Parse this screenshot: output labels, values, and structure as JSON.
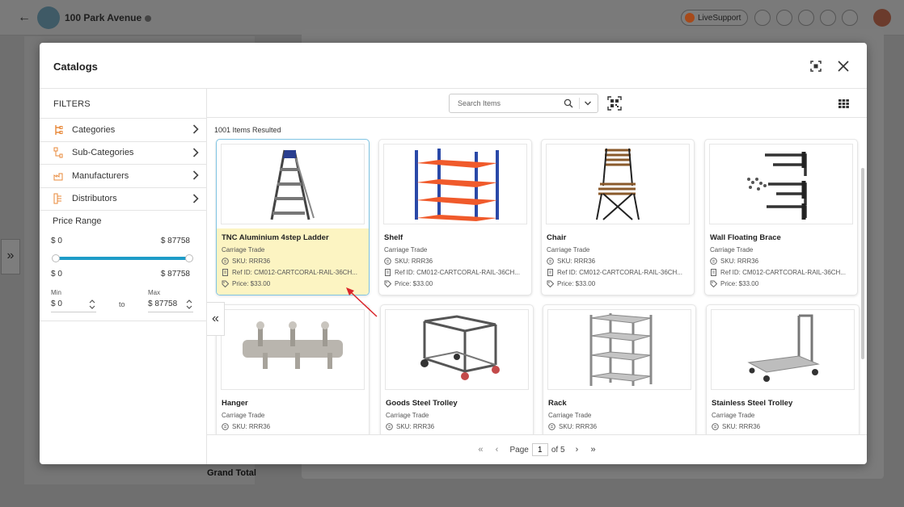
{
  "background": {
    "address": "100 Park Avenue",
    "live_support_label": "LiveSupport",
    "grand_total_label": "Grand Total"
  },
  "modal": {
    "title": "Catalogs"
  },
  "filters": {
    "title": "FILTERS",
    "items": [
      {
        "label": "Categories",
        "icon": "categories-icon"
      },
      {
        "label": "Sub-Categories",
        "icon": "sub-categories-icon"
      },
      {
        "label": "Manufacturers",
        "icon": "manufacturers-icon"
      },
      {
        "label": "Distributors",
        "icon": "distributors-icon"
      }
    ],
    "price_range": {
      "title": "Price Range",
      "min_display": "$ 0",
      "max_display": "$ 87758",
      "min_label": "Min",
      "max_label": "Max",
      "min_value": "$ 0",
      "max_value": "$ 87758",
      "to_label": "to"
    }
  },
  "search": {
    "placeholder": "Search Items"
  },
  "results_text": "1001 Items Resulted",
  "products": [
    {
      "name": "TNC Aluminium 4step Ladder",
      "vendor": "Carriage Trade",
      "sku": "SKU: RRR36",
      "ref": "Ref ID: CM012-CARTCORAL-RAIL-36CH...",
      "price": "Price: $33.00",
      "image": "ladder"
    },
    {
      "name": "Shelf",
      "vendor": "Carriage Trade",
      "sku": "SKU: RRR36",
      "ref": "Ref ID: CM012-CARTCORAL-RAIL-36CH...",
      "price": "Price: $33.00",
      "image": "shelf"
    },
    {
      "name": "Chair",
      "vendor": "Carriage Trade",
      "sku": "SKU: RRR36",
      "ref": "Ref ID: CM012-CARTCORAL-RAIL-36CH...",
      "price": "Price: $33.00",
      "image": "chair"
    },
    {
      "name": "Wall Floating Brace",
      "vendor": "Carriage Trade",
      "sku": "SKU: RRR36",
      "ref": "Ref ID: CM012-CARTCORAL-RAIL-36CH...",
      "price": "Price: $33.00",
      "image": "brace"
    },
    {
      "name": "Hanger",
      "vendor": "Carriage Trade",
      "sku": "SKU: RRR36",
      "ref": "",
      "price": "",
      "image": "hanger"
    },
    {
      "name": "Goods Steel Trolley",
      "vendor": "Carriage Trade",
      "sku": "SKU: RRR36",
      "ref": "",
      "price": "",
      "image": "trolley"
    },
    {
      "name": "Rack",
      "vendor": "Carriage Trade",
      "sku": "SKU: RRR36",
      "ref": "",
      "price": "",
      "image": "rack"
    },
    {
      "name": "Stainless Steel Trolley",
      "vendor": "Carriage Trade",
      "sku": "SKU: RRR36",
      "ref": "",
      "price": "",
      "image": "steel-trolley"
    }
  ],
  "pagination": {
    "page_label": "Page",
    "current_page": "1",
    "of_label": "of 5"
  },
  "colors": {
    "accent": "#1e9cc8",
    "selected_bg": "#fcf4c2",
    "selected_border": "#7fc4e3",
    "annotation_arrow": "#d9252a"
  }
}
